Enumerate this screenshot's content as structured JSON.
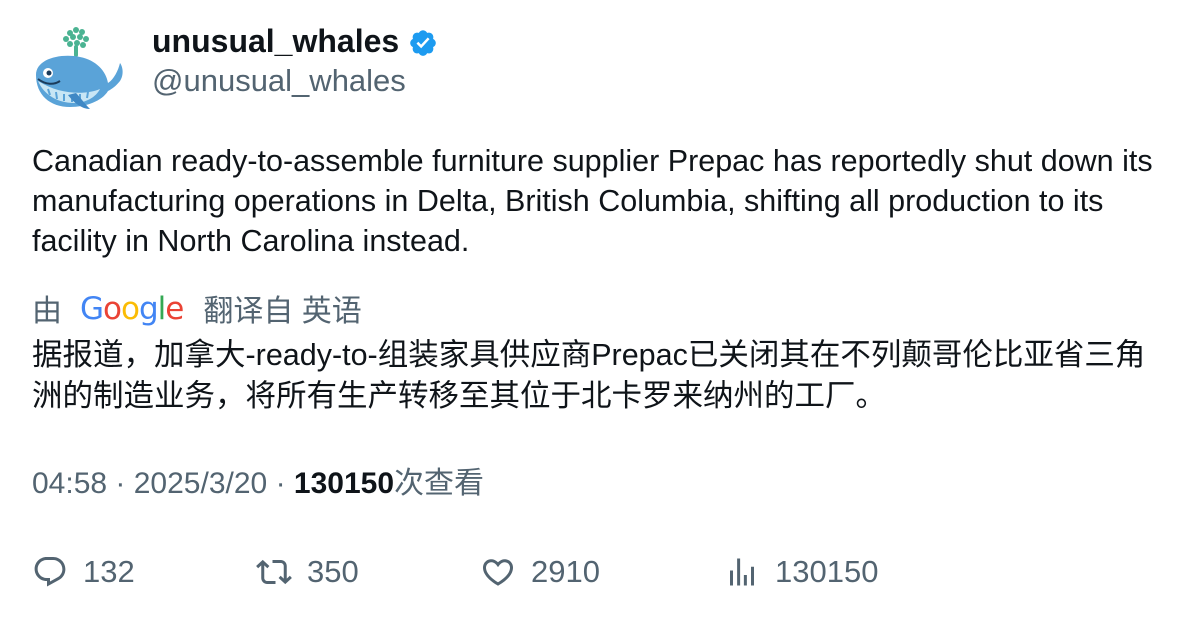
{
  "author": {
    "display_name": "unusual_whales",
    "handle": "@unusual_whales",
    "verified_icon": "verified-badge-icon",
    "avatar_icon": "whale-avatar-icon"
  },
  "tweet": {
    "text": "Canadian ready-to-assemble furniture supplier Prepac has reportedly shut down its manufacturing operations in Delta, British Columbia, shifting all production to its facility in North Carolina instead."
  },
  "translation": {
    "by_label": "由",
    "provider_logo_text": "Google",
    "translated_from_label": "翻译自 英语",
    "text": "据报道，加拿大-ready-to-组装家具供应商Prepac已关闭其在不列颠哥伦比亚省三角洲的制造业务，将所有生产转移至其位于北卡罗来纳州的工厂。"
  },
  "meta": {
    "time": "04:58",
    "separator": "·",
    "date": "2025/3/20",
    "views_count": "130150",
    "views_label": "次查看"
  },
  "actions": {
    "replies": "132",
    "retweets": "350",
    "likes": "2910",
    "views": "130150"
  },
  "colors": {
    "text_primary": "#0f1419",
    "text_secondary": "#536471",
    "verified_blue": "#1d9bf0",
    "google_blue": "#4285f4",
    "google_red": "#ea4335",
    "google_yellow": "#fbbc05",
    "google_green": "#34a853"
  }
}
